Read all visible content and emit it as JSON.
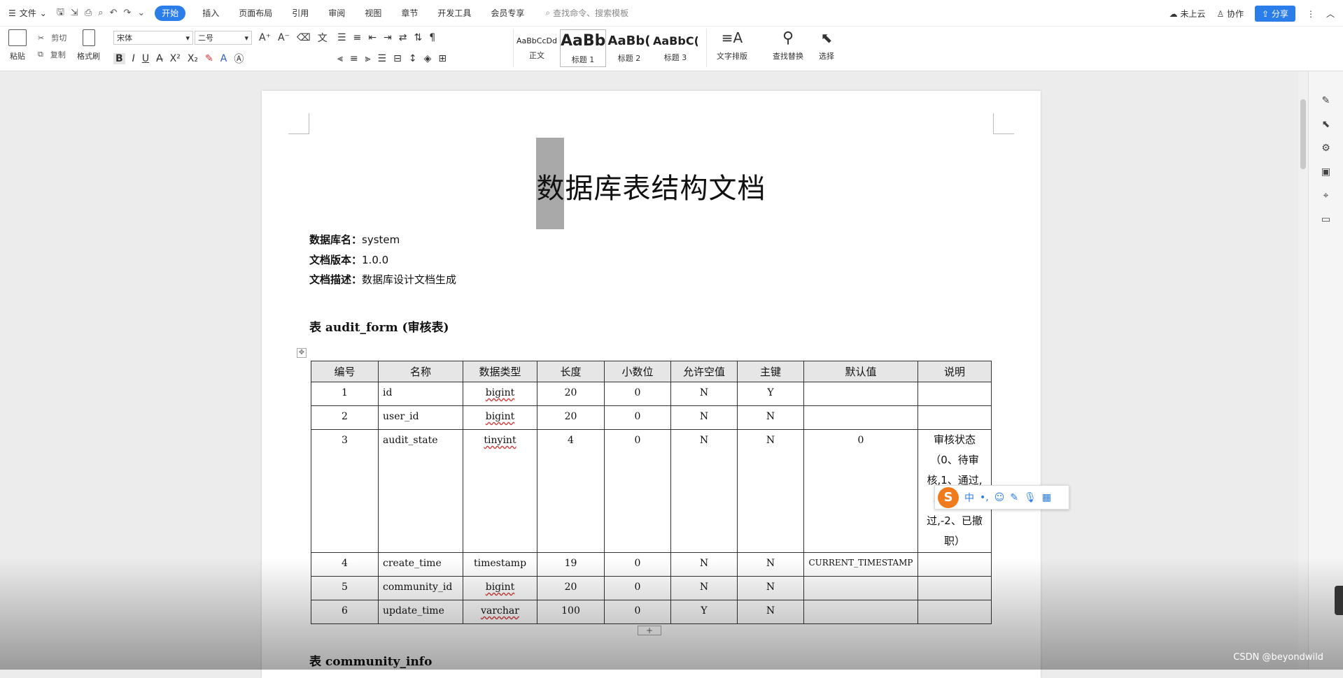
{
  "menubar": {
    "file_label": "文件",
    "tabs": [
      "开始",
      "插入",
      "页面布局",
      "引用",
      "审阅",
      "视图",
      "章节",
      "开发工具",
      "会员专享"
    ],
    "command_search_placeholder": "查找命令、搜索模板",
    "cloud_status": "未上云",
    "collab_label": "协作",
    "share_label": "分享"
  },
  "ribbon": {
    "paste_label": "粘贴",
    "cut_label": "剪切",
    "copy_label": "复制",
    "format_painter_label": "格式刷",
    "font_name": "宋体",
    "font_size": "二号",
    "styles": [
      {
        "preview": "AaBbCcDd",
        "name": "正文"
      },
      {
        "preview": "AaBb",
        "name": "标题 1"
      },
      {
        "preview": "AaBb(",
        "name": "标题 2"
      },
      {
        "preview": "AaBbC(",
        "name": "标题 3"
      }
    ],
    "text_layout_label": "文字排版",
    "find_replace_label": "查找替换",
    "select_label": "选择"
  },
  "document": {
    "title": "数据库表结构文档",
    "db_name_label": "数据库名：",
    "db_name_value": "system",
    "version_label": "文档版本：",
    "version_value": "1.0.0",
    "desc_label": "文档描述：",
    "desc_value": "数据库设计文档生成",
    "table1_heading": "表 audit_form (审核表)",
    "table2_heading": "表 community_info",
    "columns": [
      "编号",
      "名称",
      "数据类型",
      "长度",
      "小数位",
      "允许空值",
      "主键",
      "默认值",
      "说明"
    ],
    "rows": [
      {
        "no": "1",
        "name": "id",
        "type": "bigint",
        "len": "20",
        "dec": "0",
        "nullable": "N",
        "pk": "Y",
        "default": "",
        "desc": ""
      },
      {
        "no": "2",
        "name": "user_id",
        "type": "bigint",
        "len": "20",
        "dec": "0",
        "nullable": "N",
        "pk": "N",
        "default": "",
        "desc": ""
      },
      {
        "no": "3",
        "name": "audit_state",
        "type": "tinyint",
        "len": "4",
        "dec": "0",
        "nullable": "N",
        "pk": "N",
        "default": "0",
        "desc": "审核状态\n（0、待审\n核,1、通过,\n-1、未通\n过,-2、已撤\n职）"
      },
      {
        "no": "4",
        "name": "create_time",
        "type": "timestamp",
        "len": "19",
        "dec": "0",
        "nullable": "N",
        "pk": "N",
        "default": "CURRENT_TIMESTAMP",
        "desc": ""
      },
      {
        "no": "5",
        "name": "community_id",
        "type": "bigint",
        "len": "20",
        "dec": "0",
        "nullable": "N",
        "pk": "N",
        "default": "",
        "desc": ""
      },
      {
        "no": "6",
        "name": "update_time",
        "type": "varchar",
        "len": "100",
        "dec": "0",
        "nullable": "Y",
        "pk": "N",
        "default": "",
        "desc": ""
      }
    ]
  },
  "ime": {
    "logo": "S",
    "mode": "中"
  },
  "watermark": "CSDN @beyondwild"
}
